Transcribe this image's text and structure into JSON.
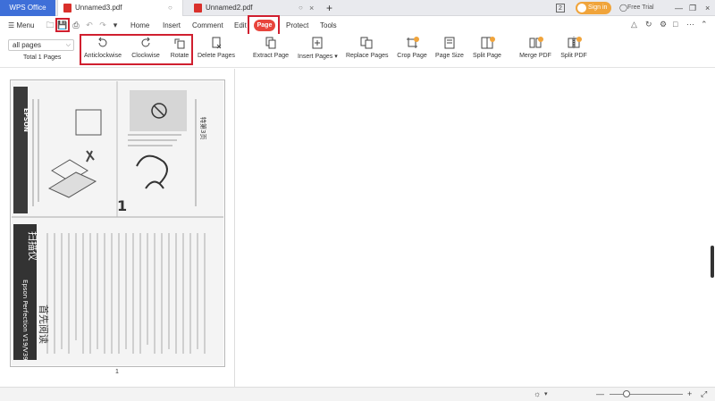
{
  "titlebar": {
    "app_tab": "WPS Office",
    "tabs": [
      {
        "label": "Unnamed3.pdf",
        "active": true
      },
      {
        "label": "Unnamed2.pdf",
        "active": false
      }
    ],
    "badge": "2",
    "sign_in": "Sign in",
    "free_trial": "Free Trial"
  },
  "menubar": {
    "menu": "Menu",
    "items": [
      "Home",
      "Insert",
      "Comment",
      "Edit",
      "Page",
      "Protect",
      "Tools"
    ],
    "active_item": "Page"
  },
  "toolbar": {
    "page_select": "all pages",
    "total_pages": "Total 1 Pages",
    "tools": [
      {
        "label": "Anticlockwise",
        "icon": "rotate-left-icon"
      },
      {
        "label": "Clockwise",
        "icon": "rotate-right-icon"
      },
      {
        "label": "Rotate",
        "icon": "rotate-page-icon"
      },
      {
        "label": "Delete Pages",
        "icon": "delete-page-icon"
      },
      {
        "label": "Extract Page",
        "icon": "extract-page-icon"
      },
      {
        "label": "Insert Pages",
        "icon": "insert-page-icon"
      },
      {
        "label": "Replace Pages",
        "icon": "replace-page-icon"
      },
      {
        "label": "Crop Page",
        "icon": "crop-page-icon"
      },
      {
        "label": "Page Size",
        "icon": "page-size-icon"
      },
      {
        "label": "Split Page",
        "icon": "split-page-icon"
      },
      {
        "label": "Merge PDF",
        "icon": "merge-pdf-icon"
      },
      {
        "label": "Split PDF",
        "icon": "split-pdf-icon"
      }
    ]
  },
  "thumbnail": {
    "page_number": "1",
    "brand": "EPSON",
    "title_cn": "扫描仪",
    "title_en": "Epson Perfection V19/V39",
    "read_first": "首先阅读",
    "side_label": "特第3页"
  },
  "colors": {
    "accent": "#3e6fd8",
    "highlight": "#d01f2f",
    "page_pill": "#e8453c",
    "signin": "#f0a43b"
  }
}
